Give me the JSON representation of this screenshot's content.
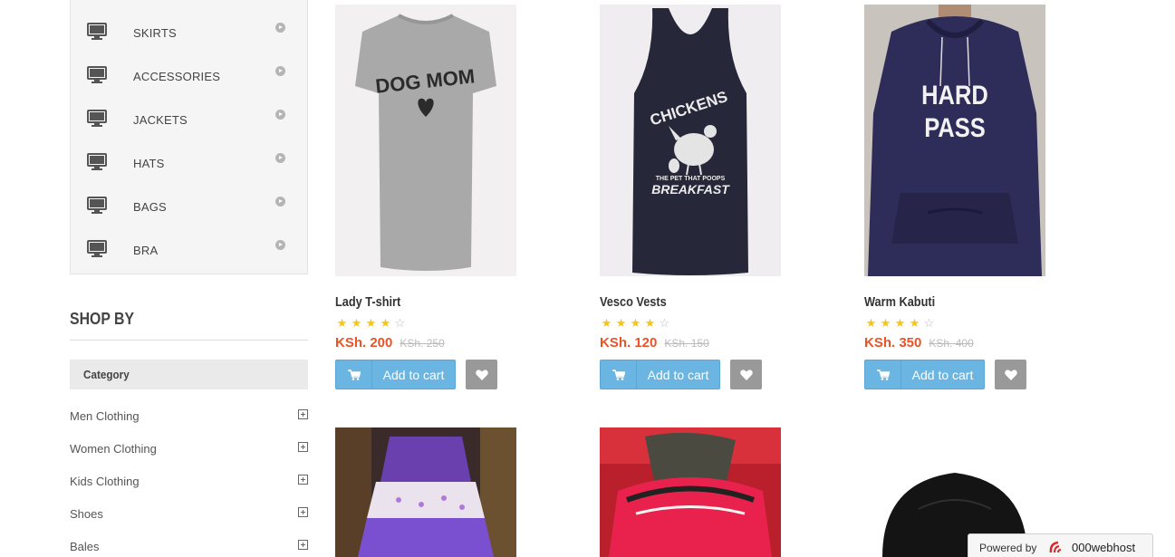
{
  "sidebar": {
    "categories": [
      {
        "label": "SKIRTS"
      },
      {
        "label": "ACCESSORIES"
      },
      {
        "label": "JACKETS"
      },
      {
        "label": "HATS"
      },
      {
        "label": "BAGS"
      },
      {
        "label": "BRA"
      }
    ],
    "shop_by_title": "SHOP BY",
    "filter_header": "Category",
    "filters": [
      {
        "label": "Men Clothing"
      },
      {
        "label": "Women Clothing"
      },
      {
        "label": "Kids Clothing"
      },
      {
        "label": "Shoes"
      },
      {
        "label": "Bales"
      }
    ]
  },
  "products": [
    {
      "name": "Lady T-shirt",
      "price": "KSh. 200",
      "old_price": "KSh. 250",
      "rating": 4,
      "max_rating": 5,
      "add_label": "Add to cart",
      "image_text": [
        "DOG MOM"
      ]
    },
    {
      "name": "Vesco Vests",
      "price": "KSh. 120",
      "old_price": "KSh. 150",
      "rating": 4,
      "max_rating": 5,
      "add_label": "Add to cart",
      "image_text": [
        "CHICKENS",
        "THE PET THAT POOPS",
        "BREAKFAST"
      ]
    },
    {
      "name": "Warm Kabuti",
      "price": "KSh. 350",
      "old_price": "KSh. 400",
      "rating": 4,
      "max_rating": 5,
      "add_label": "Add to cart",
      "image_text": [
        "HARD",
        "PASS"
      ]
    }
  ],
  "footer_badge": {
    "powered": "Powered by",
    "brand": "000webhost"
  },
  "colors": {
    "price": "#e8542a",
    "cart_button": "#6bb5e3",
    "wish_button": "#999999",
    "star": "#f5c518"
  }
}
